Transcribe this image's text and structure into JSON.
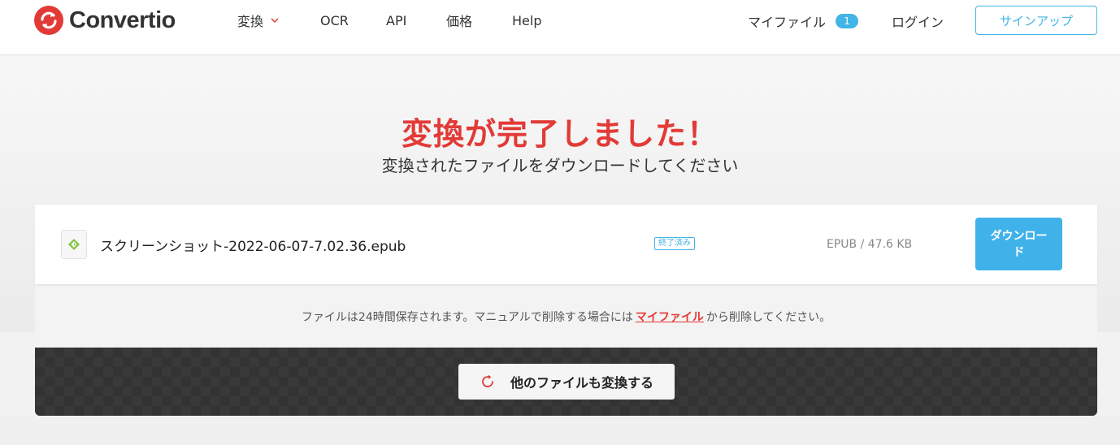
{
  "brand": {
    "name": "Convertio",
    "color": "#e23a36"
  },
  "nav": {
    "items": [
      "変換",
      "OCR",
      "API",
      "価格",
      "Help"
    ],
    "my_files_label": "マイファイル",
    "my_files_count": "1",
    "login_label": "ログイン",
    "signup_label": "サインアップ"
  },
  "hero": {
    "title": "変換が完了しました！",
    "subtitle": "変換されたファイルをダウンロードしてください"
  },
  "file": {
    "name": "スクリーンショット-2022-06-07-7.02.36.epub",
    "status": "終了済み",
    "meta": "EPUB / 47.6 KB",
    "download_label": "ダウンロード"
  },
  "notice": {
    "before": "ファイルは24時間保存されます。マニュアルで削除する場合には",
    "link": "マイファイル",
    "after": "から削除してください。"
  },
  "actions": {
    "convert_more_label": "他のファイルも変換する"
  },
  "colors": {
    "accent": "#42b4e6",
    "brand_red": "#e23a36",
    "dark_panel": "#333333"
  },
  "icons": [
    "convertio-logo-icon",
    "chevron-down-icon",
    "epub-file-icon",
    "refresh-icon"
  ]
}
